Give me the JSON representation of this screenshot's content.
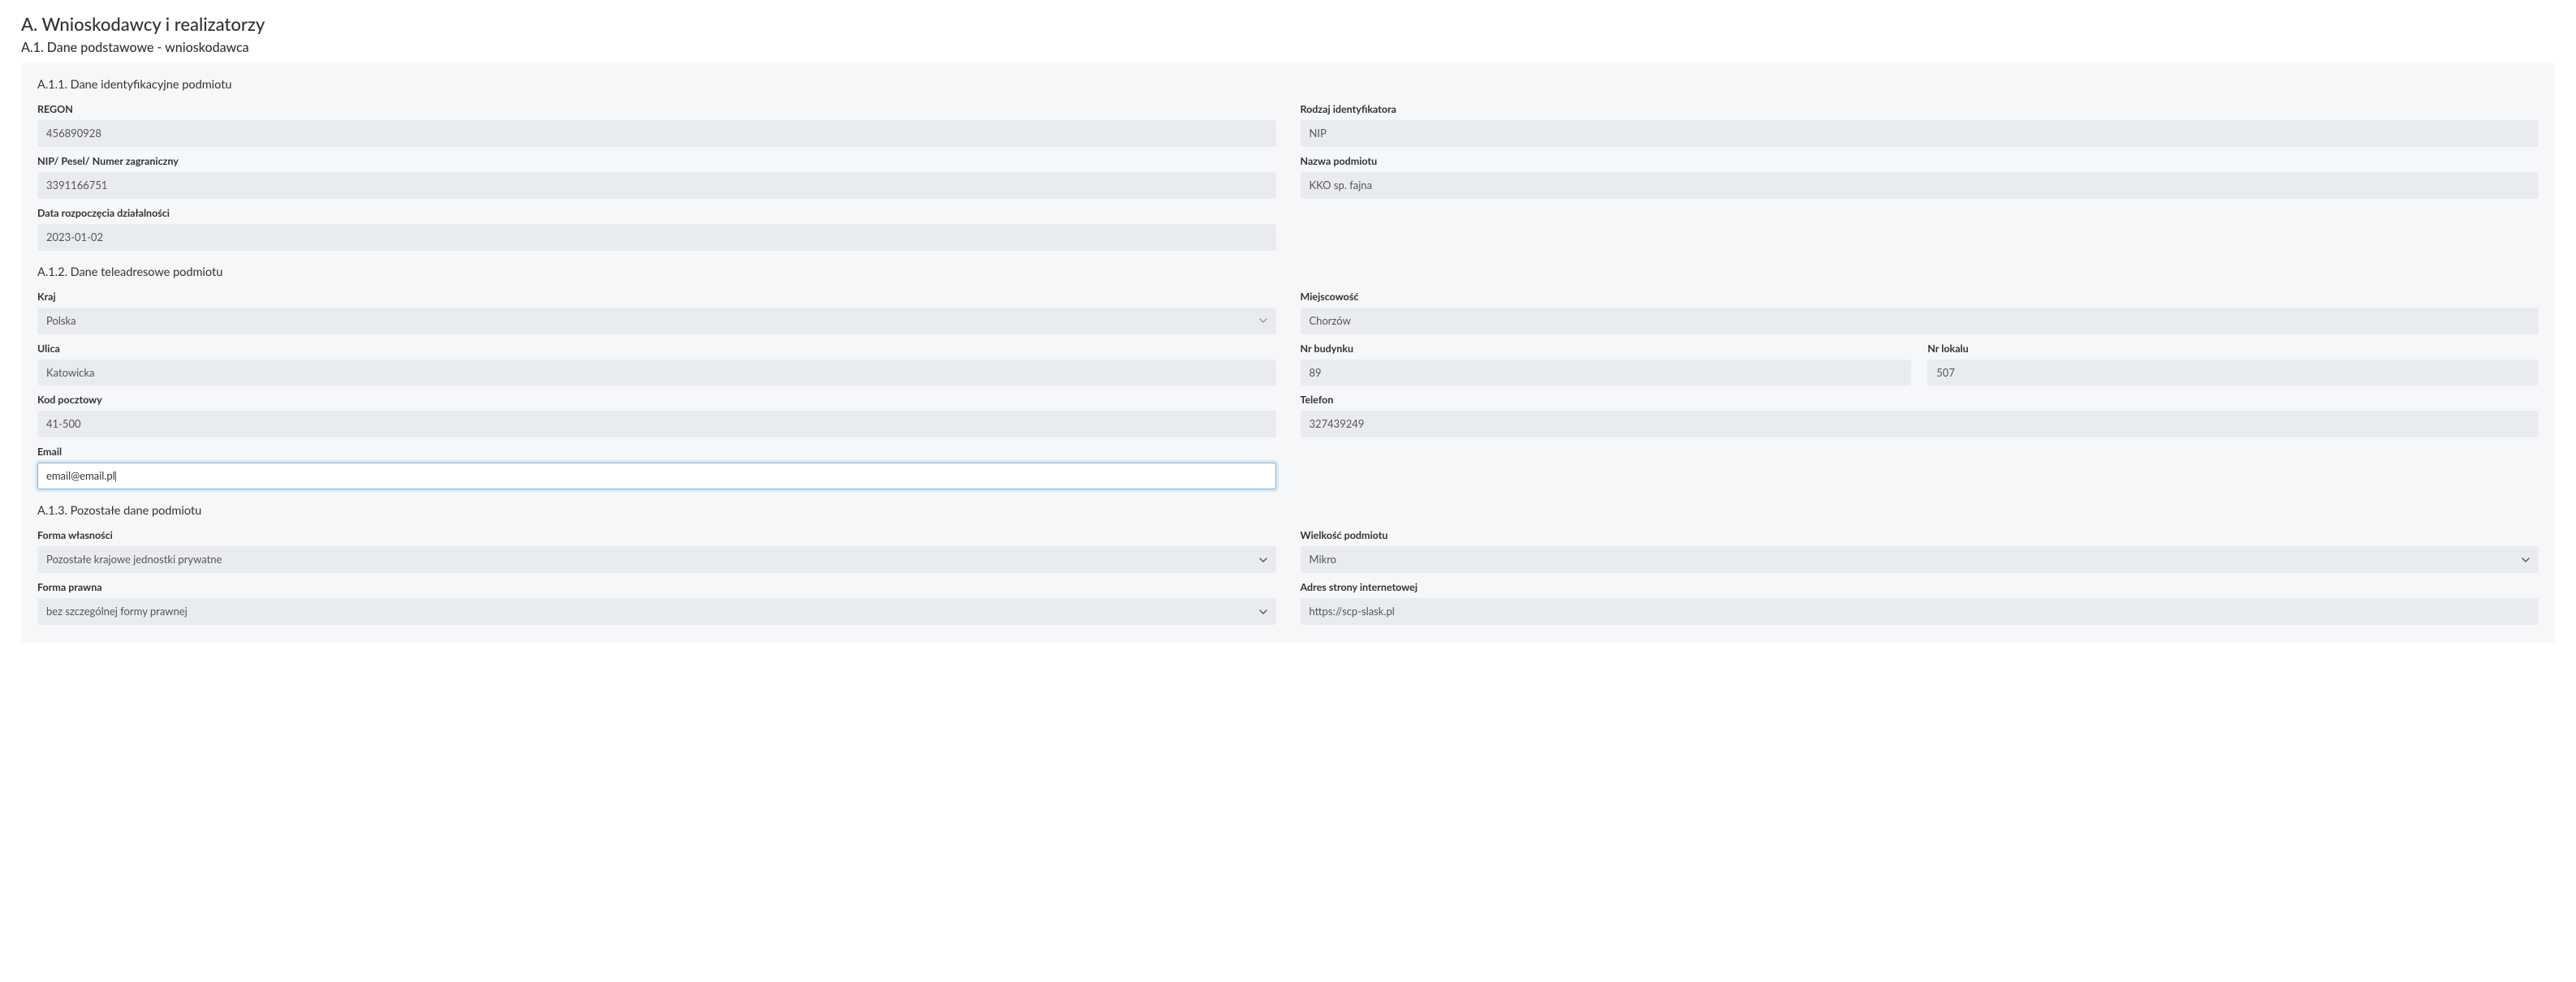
{
  "headings": {
    "main": "A. Wnioskodawcy i realizatorzy",
    "sub": "A.1. Dane podstawowe - wnioskodawca"
  },
  "sections": {
    "a11": "A.1.1. Dane identyfikacyjne podmiotu",
    "a12": "A.1.2. Dane teleadresowe podmiotu",
    "a13": "A.1.3. Pozostałe dane podmiotu"
  },
  "labels": {
    "regon": "REGON",
    "rodzaj_id": "Rodzaj identyfikatora",
    "nip_pesel": "NIP/ Pesel/ Numer zagraniczny",
    "nazwa": "Nazwa podmiotu",
    "data_rozp": "Data rozpoczęcia działalności",
    "kraj": "Kraj",
    "miejscowosc": "Miejscowość",
    "ulica": "Ulica",
    "nr_budynku": "Nr budynku",
    "nr_lokalu": "Nr lokalu",
    "kod": "Kod pocztowy",
    "telefon": "Telefon",
    "email": "Email",
    "forma_wl": "Forma własności",
    "wielkosc": "Wielkość podmiotu",
    "forma_pr": "Forma prawna",
    "adres_www": "Adres strony internetowej"
  },
  "values": {
    "regon": "456890928",
    "rodzaj_id": "NIP",
    "nip_pesel": "3391166751",
    "nazwa": "KKO sp. fajna",
    "data_rozp": "2023-01-02",
    "kraj": "Polska",
    "miejscowosc": "Chorzów",
    "ulica": "Katowicka",
    "nr_budynku": "89",
    "nr_lokalu": "507",
    "kod": "41-500",
    "telefon": "327439249",
    "email": "email@email.pl",
    "forma_wl": "Pozostałe krajowe jednostki prywatne",
    "wielkosc": "Mikro",
    "forma_pr": "bez szczególnej formy prawnej",
    "adres_www": "https://scp-slask.pl"
  }
}
